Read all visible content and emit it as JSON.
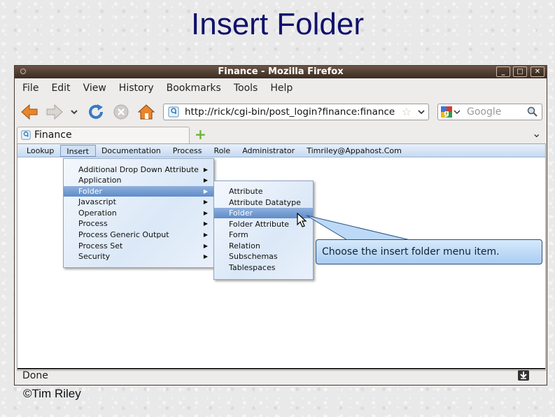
{
  "slide": {
    "title": "Insert Folder",
    "copyright": "©Tim Riley"
  },
  "window": {
    "title": "Finance - Mozilla Firefox",
    "min_glyph": "_",
    "max_glyph": "□",
    "close_glyph": "✕"
  },
  "menubar": {
    "items": [
      "File",
      "Edit",
      "View",
      "History",
      "Bookmarks",
      "Tools",
      "Help"
    ]
  },
  "navbar": {
    "url": "http://rick/cgi-bin/post_login?finance:finance",
    "search_placeholder": "Google",
    "icons": [
      "back-arrow-icon",
      "forward-arrow-icon",
      "history-dropdown-icon",
      "reload-icon",
      "stop-icon",
      "home-icon"
    ]
  },
  "tab": {
    "label": "Finance",
    "new_tab_glyph": "+",
    "list_glyph": "⌄"
  },
  "app_menu": {
    "items": [
      "Lookup",
      "Insert",
      "Documentation",
      "Process",
      "Role",
      "Administrator",
      "Timriley@Appahost.Com"
    ],
    "active": "Insert"
  },
  "insert_menu": {
    "items": [
      {
        "label": "Additional Drop Down Attribute",
        "submenu": true
      },
      {
        "label": "Application",
        "submenu": true
      },
      {
        "label": "Folder",
        "submenu": true,
        "selected": true
      },
      {
        "label": "Javascript",
        "submenu": true
      },
      {
        "label": "Operation",
        "submenu": true
      },
      {
        "label": "Process",
        "submenu": true
      },
      {
        "label": "Process Generic Output",
        "submenu": true
      },
      {
        "label": "Process Set",
        "submenu": true
      },
      {
        "label": "Security",
        "submenu": true
      }
    ],
    "arrow_glyph": "▶"
  },
  "folder_submenu": {
    "items": [
      {
        "label": "Attribute"
      },
      {
        "label": "Attribute Datatype"
      },
      {
        "label": "Folder",
        "selected": true
      },
      {
        "label": "Folder Attribute"
      },
      {
        "label": "Form"
      },
      {
        "label": "Relation"
      },
      {
        "label": "Subschemas"
      },
      {
        "label": "Tablespaces"
      }
    ]
  },
  "callout": {
    "text": "Choose the insert folder menu item."
  },
  "status": {
    "text": "Done"
  },
  "colors": {
    "title": "#11116b",
    "menu_highlight": "#5f8cc9",
    "callout_fill": "#bcdaf7"
  }
}
